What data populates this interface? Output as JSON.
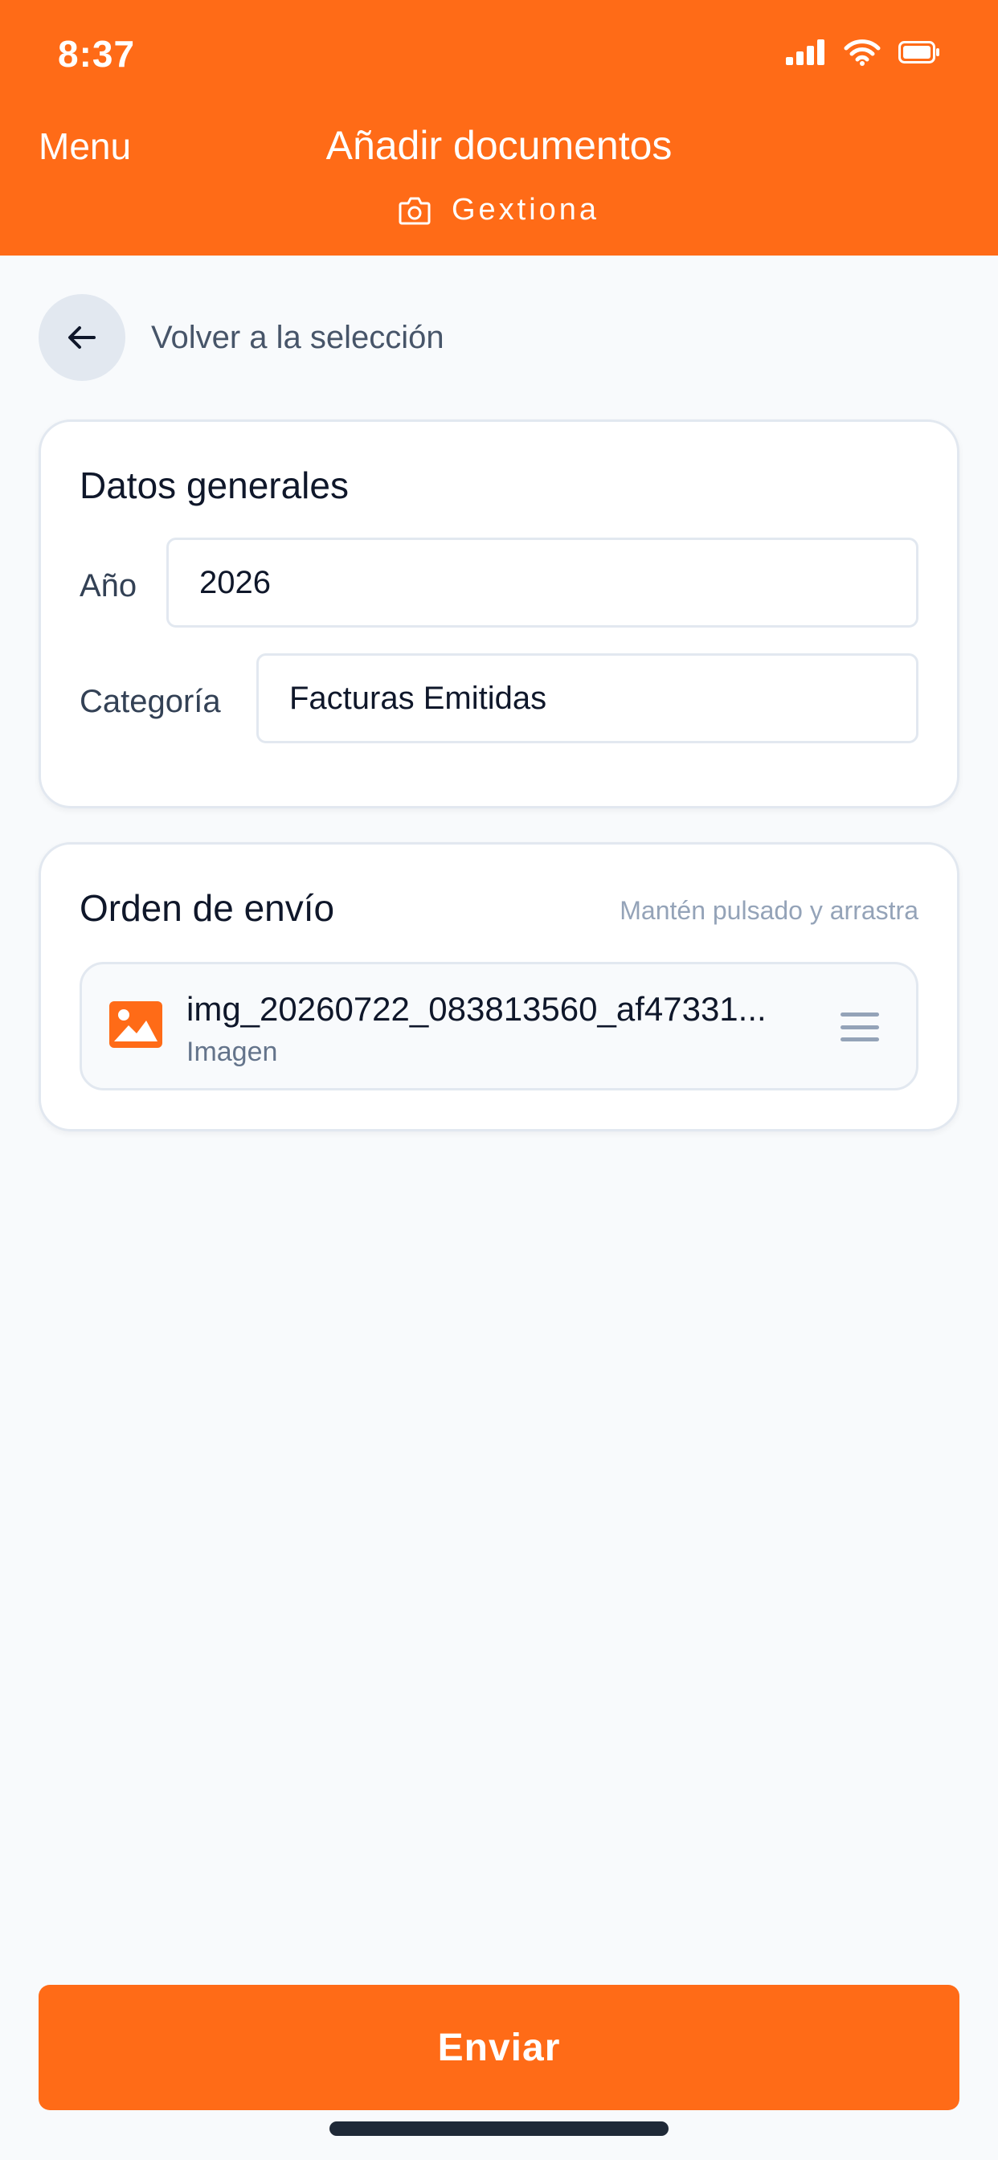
{
  "status_bar": {
    "time": "8:37"
  },
  "header": {
    "menu_label": "Menu",
    "title": "Añadir documentos",
    "subtitle": "Gextiona",
    "background_color": "#ff6b17"
  },
  "back": {
    "label": "Volver a la selección"
  },
  "general": {
    "title": "Datos generales",
    "year_label": "Año",
    "year_value": "2026",
    "category_label": "Categoría",
    "category_value": "Facturas Emitidas"
  },
  "order": {
    "title": "Orden de envío",
    "hint": "Mantén pulsado y arrastra",
    "items": [
      {
        "name": "img_20260722_083813560_af47331...",
        "type": "Imagen",
        "icon": "image-icon"
      }
    ]
  },
  "submit": {
    "label": "Enviar",
    "color": "#ff6b17"
  }
}
